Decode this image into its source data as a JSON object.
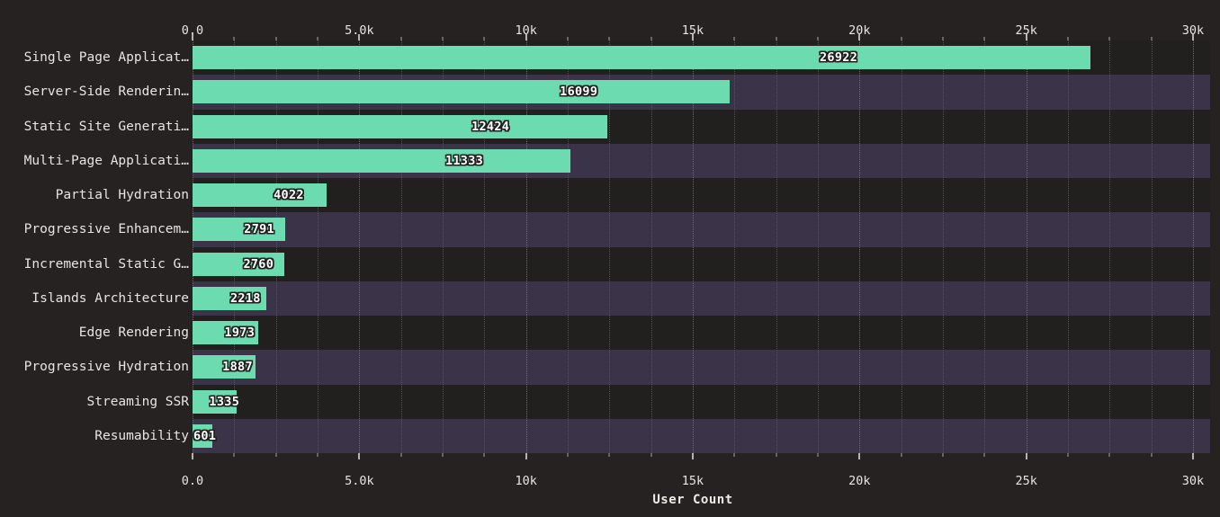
{
  "chart_data": {
    "type": "bar",
    "orientation": "horizontal",
    "title": "",
    "xlabel": "User Count",
    "ylabel": "",
    "xlim": [
      0,
      30000
    ],
    "grid": true,
    "legend": false,
    "categories": [
      "Single Page Applicat…",
      "Server-Side Renderin…",
      "Static Site Generati…",
      "Multi-Page Applicati…",
      "Partial Hydration",
      "Progressive Enhancem…",
      "Incremental Static G…",
      "Islands Architecture",
      "Edge Rendering",
      "Progressive Hydration",
      "Streaming SSR",
      "Resumability"
    ],
    "values": [
      26922,
      16099,
      12424,
      11333,
      4022,
      2791,
      2760,
      2218,
      1973,
      1887,
      1335,
      601
    ],
    "value_labels": [
      "26922",
      "16099",
      "12424",
      "11333",
      "4022",
      "2791",
      "2760",
      "2218",
      "1973",
      "1887",
      "1335",
      "601"
    ],
    "x_ticks": [
      0,
      5000,
      10000,
      15000,
      20000,
      25000,
      30000
    ],
    "x_tick_labels": [
      "0.0",
      "5.0k",
      "10k",
      "15k",
      "20k",
      "25k",
      "30k"
    ],
    "x_minor_tick_step": 1250,
    "bar_color": "#6ddbb0",
    "plot_background": "#221f1f",
    "band_color": "#3b3348",
    "page_background": "#252221",
    "label_text_color": "#ffffff",
    "axis_text_color": "#e8e4e0"
  }
}
